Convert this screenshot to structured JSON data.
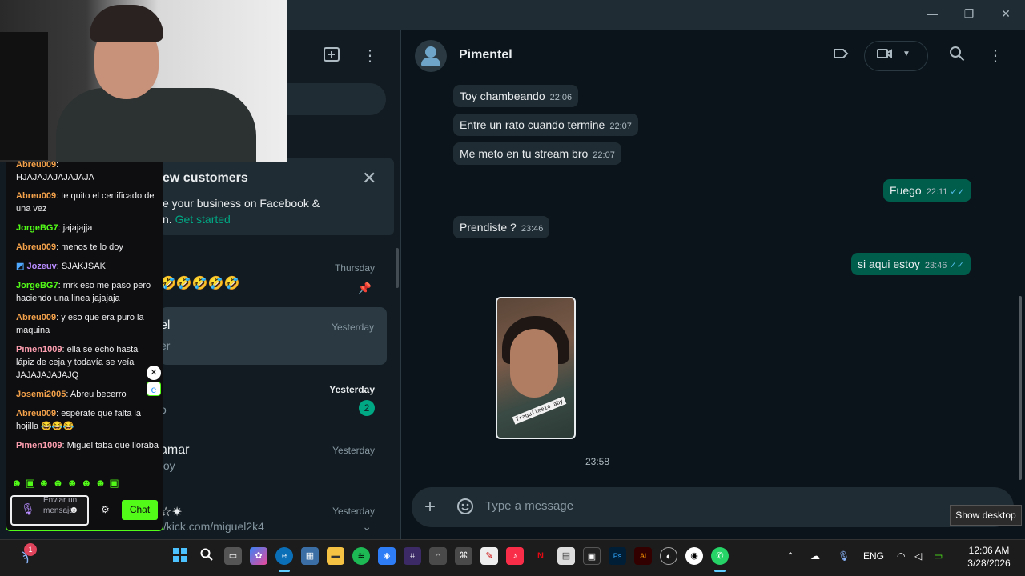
{
  "window": {
    "minimize": "—",
    "restore": "❐",
    "close": "✕"
  },
  "left_panel": {
    "header_icons": [
      "new-chat-icon",
      "menu-dots-icon"
    ],
    "filter_fragment": "s",
    "banner": {
      "title": "ew customers",
      "text": "e your business on Facebook &",
      "text2": "n. ",
      "link": "Get started"
    },
    "chats": [
      {
        "name": "",
        "time": "Thursday",
        "preview": "🤣🤣🤣🤣🤣",
        "pinned": true
      },
      {
        "name": "el",
        "time": "Yesterday",
        "preview": "er"
      },
      {
        "name": "",
        "time": "Yesterday",
        "preview": "o",
        "unread": "2"
      },
      {
        "name": "amar",
        "time": "Yesterday",
        "preview": "toy"
      },
      {
        "name": "☆✷",
        "time": "Yesterday",
        "preview": "//kick.com/miguel2k4"
      }
    ]
  },
  "conversation": {
    "contact": "Pimentel",
    "messages": [
      {
        "dir": "in",
        "text": "Toy chambeando",
        "time": "22:06"
      },
      {
        "dir": "in",
        "text": "Entre un rato cuando termine",
        "time": "22:07"
      },
      {
        "dir": "in",
        "text": "Me meto en tu stream bro",
        "time": "22:07"
      },
      {
        "dir": "out",
        "text": "Fuego",
        "time": "22:11"
      },
      {
        "dir": "in",
        "text": "Prendiste ?",
        "time": "23:46"
      },
      {
        "dir": "out",
        "text": "si aqui estoy",
        "time": "23:46"
      }
    ],
    "photo_label": "Traquilmeio aby",
    "photo_time": "23:58",
    "input_placeholder": "Type a message",
    "tooltip": "Show desktop"
  },
  "stream_chat": {
    "messages": [
      {
        "user": "Abreu009",
        "color": "orange",
        "text": "HJAJAJAJAJAJAJA"
      },
      {
        "user": "Abreu009",
        "color": "orange",
        "text": "te quito el certificado de una vez"
      },
      {
        "user": "JorgeBG7",
        "color": "green",
        "text": "jajajajja"
      },
      {
        "user": "Abreu009",
        "color": "orange",
        "text": "menos te lo doy"
      },
      {
        "user": "Jozeuv",
        "color": "purple",
        "text": "SJAKJSAK"
      },
      {
        "user": "JorgeBG7",
        "color": "green",
        "text": "mrk eso me paso pero haciendo una linea jajajaja"
      },
      {
        "user": "Abreu009",
        "color": "orange",
        "text": "y eso que era puro la maquina"
      },
      {
        "user": "Pimen1009",
        "color": "pink",
        "text": "ella se echó hasta lápiz de ceja y todavía se veía JAJAJAJAJAJQ"
      },
      {
        "user": "Josemi2005",
        "color": "orange",
        "text": "Abreu becerro"
      },
      {
        "user": "Abreu009",
        "color": "orange",
        "text": "espérate que falta la hojilla 😂😂😂"
      },
      {
        "user": "Pimen1009",
        "color": "pink",
        "text": "Miguel taba que lloraba"
      }
    ],
    "emotes": "☻▣☻☻☻☻☻▣",
    "input_placeholder": "Enviar un mensaje",
    "send_label": "Chat"
  },
  "taskbar": {
    "notification_count": "1",
    "tray_lang": "ENG",
    "time": "12:06 AM",
    "date": "3/28/2026"
  }
}
